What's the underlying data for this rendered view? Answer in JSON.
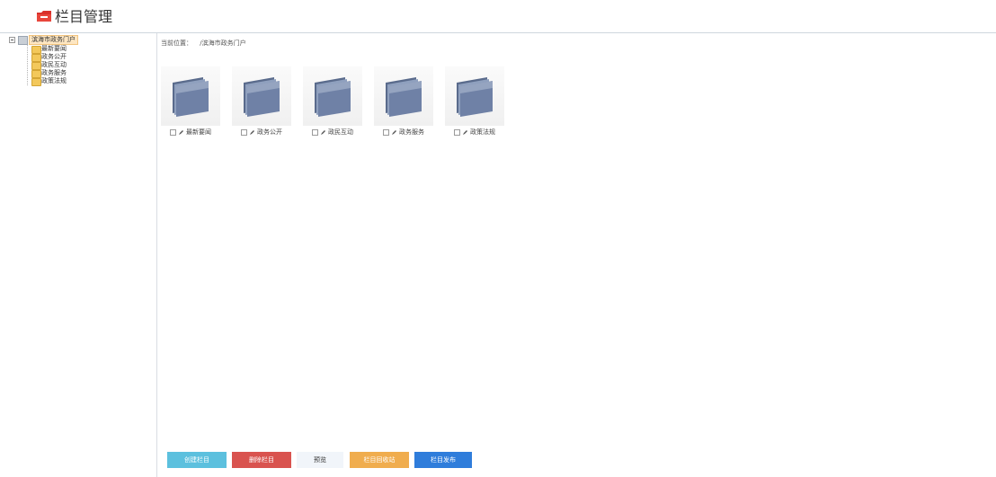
{
  "header": {
    "title": "栏目管理",
    "icon": "red-folder-icon"
  },
  "sidebar": {
    "root": {
      "label": "滨海市政务门户"
    },
    "items": [
      {
        "label": "最新要闻"
      },
      {
        "label": "政务公开"
      },
      {
        "label": "政民互动"
      },
      {
        "label": "政务服务"
      },
      {
        "label": "政策法规"
      }
    ]
  },
  "main": {
    "breadcrumb_prefix": "当前位置：",
    "breadcrumb_path": "/滨海市政务门户",
    "folders": [
      {
        "label": "最新要闻"
      },
      {
        "label": "政务公开"
      },
      {
        "label": "政民互动"
      },
      {
        "label": "政务服务"
      },
      {
        "label": "政策法规"
      }
    ]
  },
  "buttons": {
    "create": "创建栏目",
    "delete": "删除栏目",
    "preview": "预览",
    "recycle": "栏目回收站",
    "publish": "栏目发布"
  },
  "colors": {
    "create": "#5cc0de",
    "delete": "#d9534f",
    "recycle": "#f0ad4e",
    "publish": "#2f7ddb",
    "header_icon": "#d9312b"
  }
}
